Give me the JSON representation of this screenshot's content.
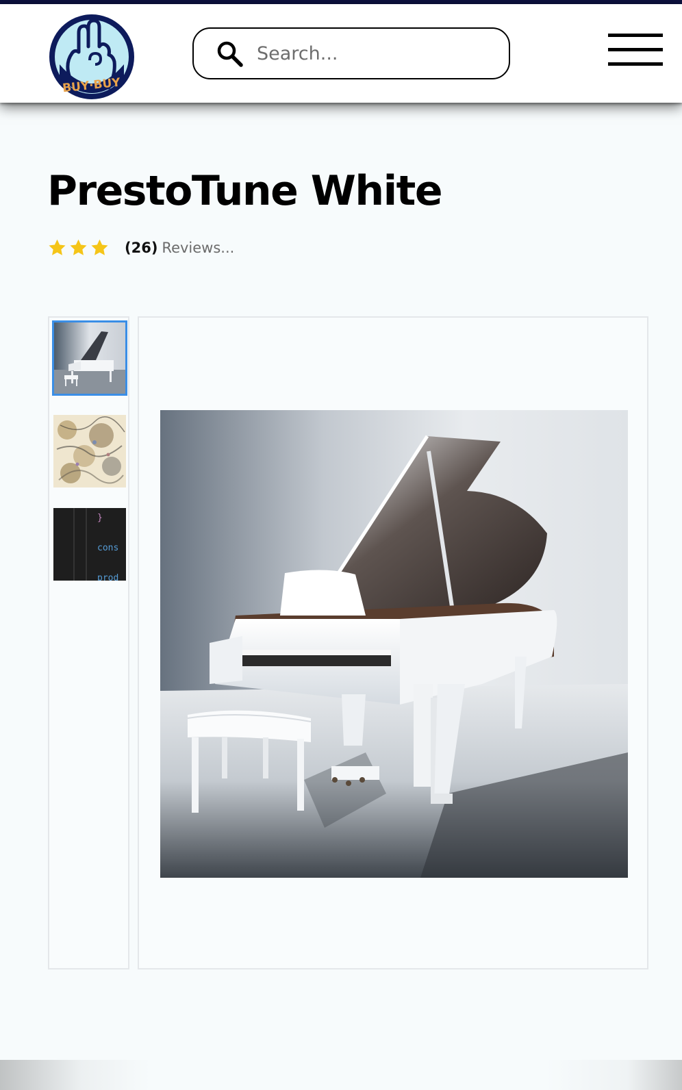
{
  "brand": {
    "logo_text": "BUY·BUY",
    "logo_icon": "hand-logo-icon",
    "primary_color": "#0d1240",
    "accent_color": "#e8a24a"
  },
  "search": {
    "placeholder": "Search..."
  },
  "menu": {
    "icon": "hamburger-menu-icon"
  },
  "product": {
    "title": "PrestoTune White",
    "rating_stars": 3,
    "review_count": "(26)",
    "reviews_label": "Reviews..."
  },
  "gallery": {
    "selected_index": 0,
    "thumbnails": [
      {
        "name": "thumbnail-white-piano"
      },
      {
        "name": "thumbnail-abstract-painting"
      },
      {
        "name": "thumbnail-code-editor",
        "lines": [
          "}",
          "cons",
          "prod"
        ]
      }
    ]
  },
  "colors": {
    "star": "#f5c518",
    "selected_outline": "#3a8ee6"
  }
}
